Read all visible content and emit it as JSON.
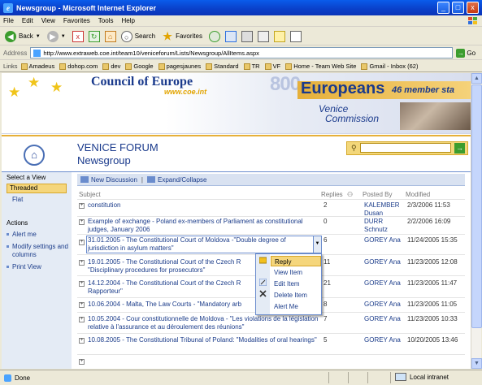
{
  "window": {
    "title": "Newsgroup - Microsoft Internet Explorer"
  },
  "menu": [
    "File",
    "Edit",
    "View",
    "Favorites",
    "Tools",
    "Help"
  ],
  "toolbar": {
    "back": "Back",
    "search": "Search",
    "favorites": "Favorites"
  },
  "address": {
    "label": "Address",
    "url": "http://www.extraweb.coe.int/team10/veniceforum/Lists/Newsgroup/AllItems.aspx",
    "go": "Go"
  },
  "links": {
    "label": "Links",
    "items": [
      "Amadeus",
      "dohop.com",
      "dev",
      "Google",
      "pagesjaunes",
      "Standard",
      "TR",
      "VF",
      "Home - Team Web Site",
      "Gmail - Inbox (62)"
    ]
  },
  "banner": {
    "org": "Council of Europe",
    "url": "www.coe.int",
    "million": "800",
    "europeans": "Europeans",
    "members": "46 member sta",
    "venice1": "Venice",
    "venice2": "Commission"
  },
  "header": {
    "title": "VENICE FORUM",
    "subtitle": "Newsgroup"
  },
  "sidebar": {
    "select_view": "Select a View",
    "views": [
      "Threaded",
      "Flat"
    ],
    "actions_heading": "Actions",
    "actions": [
      "Alert me",
      "Modify settings and columns",
      "Print View"
    ]
  },
  "commands": {
    "new": "New Discussion",
    "sep": "|",
    "expand": "Expand/Collapse"
  },
  "columns": {
    "subject": "Subject",
    "replies": "Replies",
    "posted_by": "Posted By",
    "modified": "Modified"
  },
  "rows": [
    {
      "subject": "constitution",
      "replies": "2",
      "author": "KALEMBER Dusan",
      "modified": "2/3/2006 11:53"
    },
    {
      "subject": "Example of exchange - Poland ex-members of Parliament as constitutional judges, January 2006",
      "replies": "0",
      "author": "DURR Schnutz",
      "modified": "2/2/2006 16:09"
    },
    {
      "subject": "31.01.2005 - The Constitutional Court of Moldova -\"Double degree of jurisdiction in asylum matters\"",
      "replies": "6",
      "author": "GOREY Ana",
      "modified": "11/24/2005 15:35"
    },
    {
      "subject": "19.01.2005 - The Constitutional Court of the Czech R \"Disciplinary procedures for prosecutors\"",
      "replies": "11",
      "author": "GOREY Ana",
      "modified": "11/23/2005 12:08"
    },
    {
      "subject": "14.12.2004 - The Constitutional Court of the Czech R Rapporteur\"",
      "replies": "21",
      "author": "GOREY Ana",
      "modified": "11/23/2005 11:47"
    },
    {
      "subject": "10.06.2004 - Malta, The Law Courts - \"Mandatory arb",
      "replies": "8",
      "author": "GOREY Ana",
      "modified": "11/23/2005 11:05"
    },
    {
      "subject": "10.05.2004 - Cour constitutionnelle de Moldova - \"Les violations de la législation relative à l'assurance et au déroulement des réunions\"",
      "replies": "7",
      "author": "GOREY Ana",
      "modified": "11/23/2005 10:33"
    },
    {
      "subject": "10.08.2005 - The Constitutional Tribunal of Poland: \"Modalities of oral hearings\"",
      "replies": "5",
      "author": "GOREY Ana",
      "modified": "10/20/2005 13:46"
    }
  ],
  "context_menu": [
    "Reply",
    "View Item",
    "Edit Item",
    "Delete Item",
    "Alert Me"
  ],
  "status": {
    "left": "Done",
    "zone": "Local intranet"
  }
}
